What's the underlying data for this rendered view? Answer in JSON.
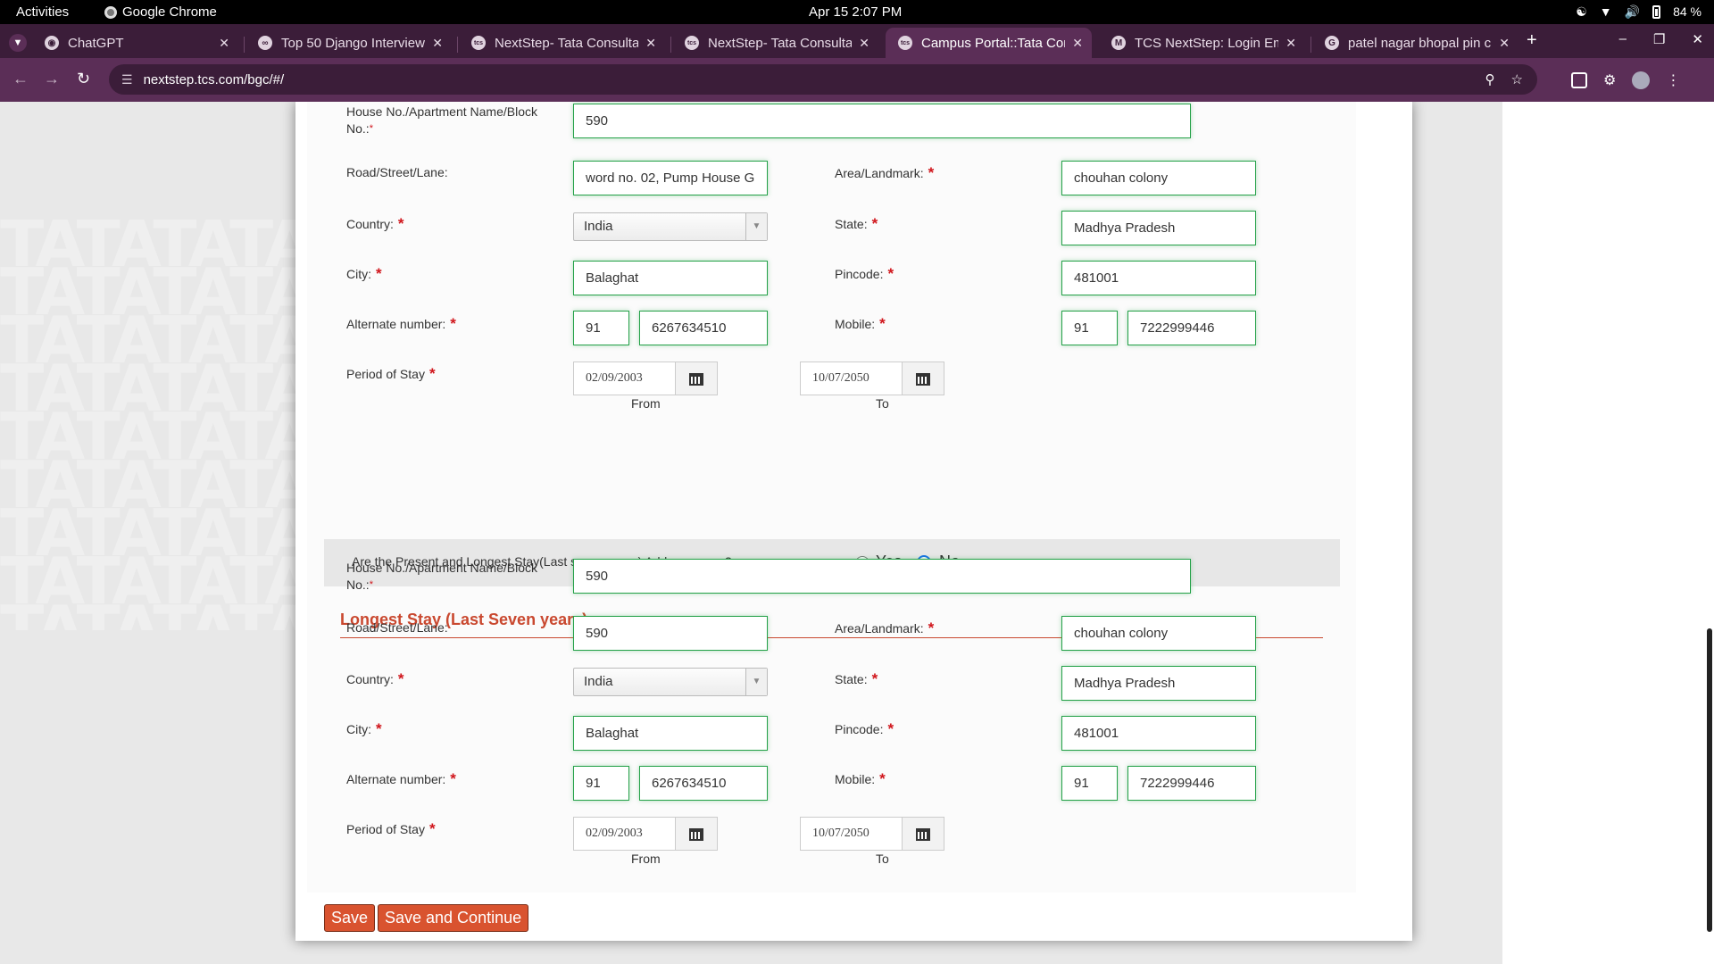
{
  "system_bar": {
    "activities": "Activities",
    "app_name": "Google Chrome",
    "clock": "Apr 15  2:07 PM",
    "battery": "84 %"
  },
  "browser": {
    "tabs": [
      {
        "title": "ChatGPT",
        "favicon": "chatgpt-icon"
      },
      {
        "title": "Top 50 Django Interview",
        "favicon": "link-icon"
      },
      {
        "title": "NextStep- Tata Consulta",
        "favicon": "tcs-icon"
      },
      {
        "title": "NextStep- Tata Consulta",
        "favicon": "tcs-icon"
      },
      {
        "title": "Campus Portal::Tata Con",
        "favicon": "tcs-icon",
        "active": true
      },
      {
        "title": "TCS NextStep: Login Em",
        "favicon": "gmail-icon"
      },
      {
        "title": "patel nagar bhopal pin c",
        "favicon": "google-icon"
      }
    ],
    "new_tab": "+",
    "url": "nextstep.tcs.com/bgc/#/"
  },
  "colors": {
    "accent_red": "#d9532f",
    "section_title": "#c9482f",
    "input_valid_border": "#24a148",
    "required_star": "#d0151b"
  },
  "background_pattern_text": "TATATATA",
  "present_address": {
    "house_label": "House No./Apartment Name/Block No.:",
    "house_value": "590",
    "road_label": "Road/Street/Lane:",
    "road_value": "word no. 02, Pump House G",
    "area_label": "Area/Landmark:",
    "area_value": "chouhan colony",
    "country_label": "Country:",
    "country_value": "India",
    "state_label": "State:",
    "state_value": "Madhya Pradesh",
    "city_label": "City:",
    "city_value": "Balaghat",
    "pincode_label": "Pincode:",
    "pincode_value": "481001",
    "alt_label": "Alternate number:",
    "alt_code": "91",
    "alt_number": "6267634510",
    "mobile_label": "Mobile:",
    "mobile_code": "91",
    "mobile_number": "7222999446",
    "period_label": "Period of Stay",
    "from_value": "02/09/2003",
    "from_caption": "From",
    "to_value": "10/07/2050",
    "to_caption": "To"
  },
  "same_address": {
    "question": "Are the Present and Longest Stay(Last seven years) Address same?",
    "yes": "Yes",
    "no": "No",
    "selected": "No"
  },
  "longest_stay": {
    "title": "Longest Stay (Last Seven years)",
    "house_label": "House No./Apartment Name/Block No.:",
    "house_value": "590",
    "road_label": "Road/Street/Lane:",
    "road_value": "590",
    "area_label": "Area/Landmark:",
    "area_value": "chouhan colony",
    "country_label": "Country:",
    "country_value": "India",
    "state_label": "State:",
    "state_value": "Madhya Pradesh",
    "city_label": "City:",
    "city_value": "Balaghat",
    "pincode_label": "Pincode:",
    "pincode_value": "481001",
    "alt_label": "Alternate number:",
    "alt_code": "91",
    "alt_number": "6267634510",
    "mobile_label": "Mobile:",
    "mobile_code": "91",
    "mobile_number": "7222999446",
    "period_label": "Period of Stay",
    "from_value": "02/09/2003",
    "from_caption": "From",
    "to_value": "10/07/2050",
    "to_caption": "To"
  },
  "actions": {
    "save": "Save",
    "save_continue": "Save and Continue"
  }
}
